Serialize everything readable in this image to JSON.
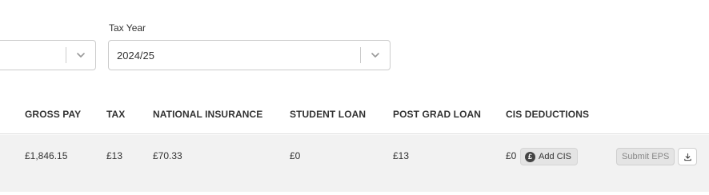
{
  "filters": {
    "period": {
      "value": ""
    },
    "tax_year": {
      "label": "Tax Year",
      "value": "2024/25"
    }
  },
  "table": {
    "columns": [
      "GROSS PAY",
      "TAX",
      "NATIONAL INSURANCE",
      "STUDENT LOAN",
      "POST GRAD LOAN",
      "CIS DEDUCTIONS"
    ],
    "row": {
      "gross_pay": "£1,846.15",
      "tax": "£13",
      "national_insurance": "£70.33",
      "student_loan": "£0",
      "post_grad_loan": "£13",
      "cis_deductions": "£0"
    },
    "actions": {
      "add_cis_label": "Add CIS",
      "add_cis_icon": "pound-coin-icon",
      "add_cis_icon_glyph": "£",
      "submit_eps_label": "Submit EPS",
      "download_icon": "download-icon"
    }
  },
  "icons": {
    "select_chevron": "chevron-down-icon"
  }
}
